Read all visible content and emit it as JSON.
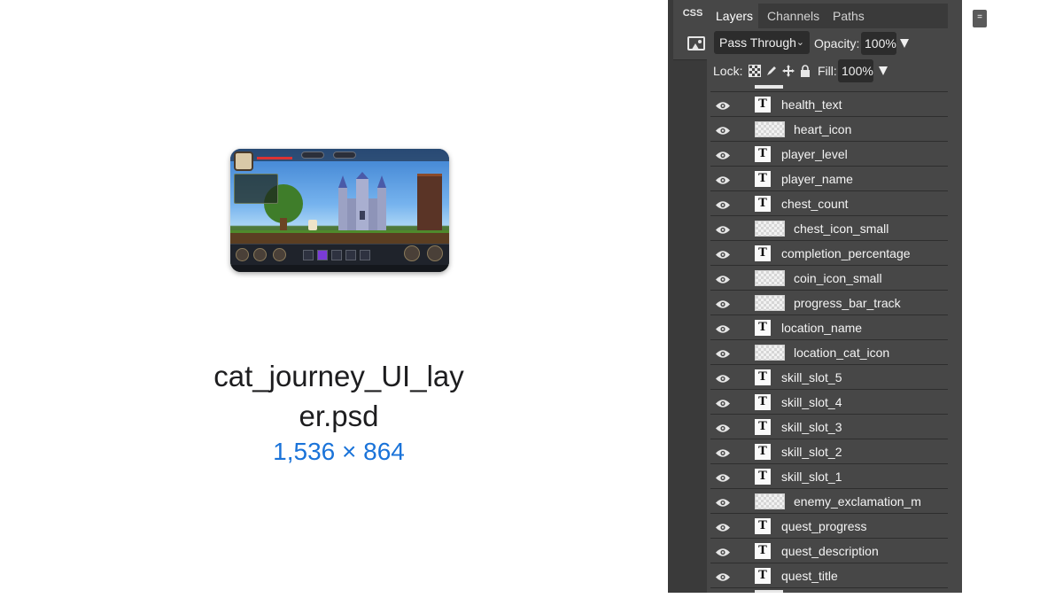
{
  "preview": {
    "filename_line1": "cat_journey_UI_lay",
    "filename_line2": "er.psd",
    "dimensions": "1,536 × 864"
  },
  "toolstrip": {
    "css_label": "CSS",
    "image_icon": "image-icon"
  },
  "tabs": [
    {
      "label": "Layers",
      "active": true
    },
    {
      "label": "Channels",
      "active": false
    },
    {
      "label": "Paths",
      "active": false
    }
  ],
  "tab_menu_icon": "=",
  "blend_mode": "Pass Through",
  "opacity_label": "Opacity:",
  "opacity_value": "100%",
  "lock_label": "Lock:",
  "fill_label": "Fill:",
  "fill_value": "100%",
  "layers": [
    {
      "name": "health_text",
      "type": "text"
    },
    {
      "name": "heart_icon",
      "type": "pixel"
    },
    {
      "name": "player_level",
      "type": "text"
    },
    {
      "name": "player_name",
      "type": "text"
    },
    {
      "name": "chest_count",
      "type": "text"
    },
    {
      "name": "chest_icon_small",
      "type": "pixel"
    },
    {
      "name": "completion_percentage",
      "type": "text"
    },
    {
      "name": "coin_icon_small",
      "type": "pixel"
    },
    {
      "name": "progress_bar_track",
      "type": "pixel"
    },
    {
      "name": "location_name",
      "type": "text"
    },
    {
      "name": "location_cat_icon",
      "type": "pixel"
    },
    {
      "name": "skill_slot_5",
      "type": "text"
    },
    {
      "name": "skill_slot_4",
      "type": "text"
    },
    {
      "name": "skill_slot_3",
      "type": "text"
    },
    {
      "name": "skill_slot_2",
      "type": "text"
    },
    {
      "name": "skill_slot_1",
      "type": "text"
    },
    {
      "name": "enemy_exclamation_m",
      "type": "pixel"
    },
    {
      "name": "quest_progress",
      "type": "text"
    },
    {
      "name": "quest_description",
      "type": "text"
    },
    {
      "name": "quest_title",
      "type": "text"
    }
  ],
  "text_layer_glyph": "T",
  "colors": {
    "panel_bg": "#474747",
    "dark_field": "#2c2c2c",
    "dimension_blue": "#1a73d9"
  }
}
